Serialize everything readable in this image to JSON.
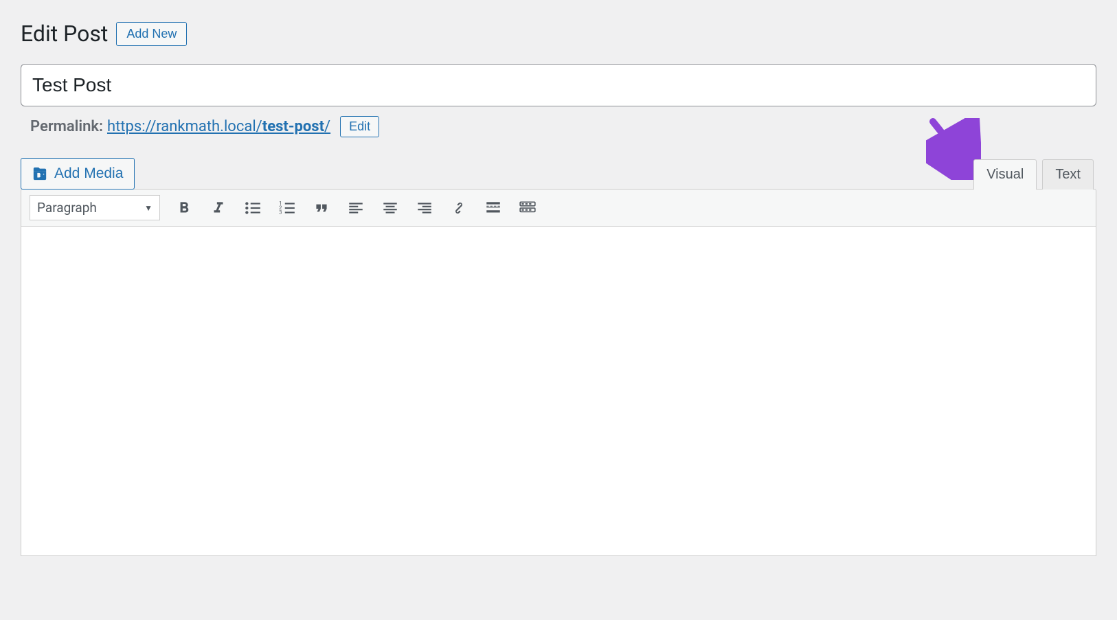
{
  "header": {
    "title": "Edit Post",
    "add_new_label": "Add New"
  },
  "post": {
    "title_value": "Test Post"
  },
  "permalink": {
    "label": "Permalink:",
    "url_prefix": "https://rankmath.local/",
    "slug": "test-post",
    "url_suffix": "/",
    "edit_label": "Edit"
  },
  "editor": {
    "add_media_label": "Add Media",
    "tabs": {
      "visual": "Visual",
      "text": "Text"
    },
    "format_selected": "Paragraph"
  }
}
